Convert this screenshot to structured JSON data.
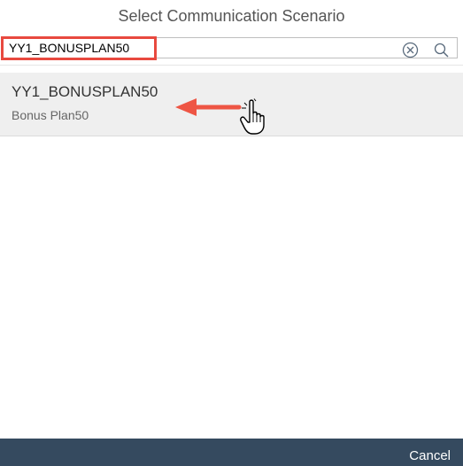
{
  "dialog": {
    "title": "Select Communication Scenario"
  },
  "search": {
    "value": "YY1_BONUSPLAN50",
    "clear_icon": "clear-circle-icon",
    "search_icon": "magnifier-icon"
  },
  "results": [
    {
      "id": "YY1_BONUSPLAN50",
      "description": "Bonus Plan50"
    }
  ],
  "footer": {
    "cancel_label": "Cancel"
  },
  "colors": {
    "highlight_red": "#e8493f",
    "footer_bg": "#354a5f",
    "selected_row_bg": "#efefef"
  },
  "annotations": {
    "arrow_icon": "left-arrow-icon",
    "cursor_icon": "hand-pointer-icon"
  }
}
